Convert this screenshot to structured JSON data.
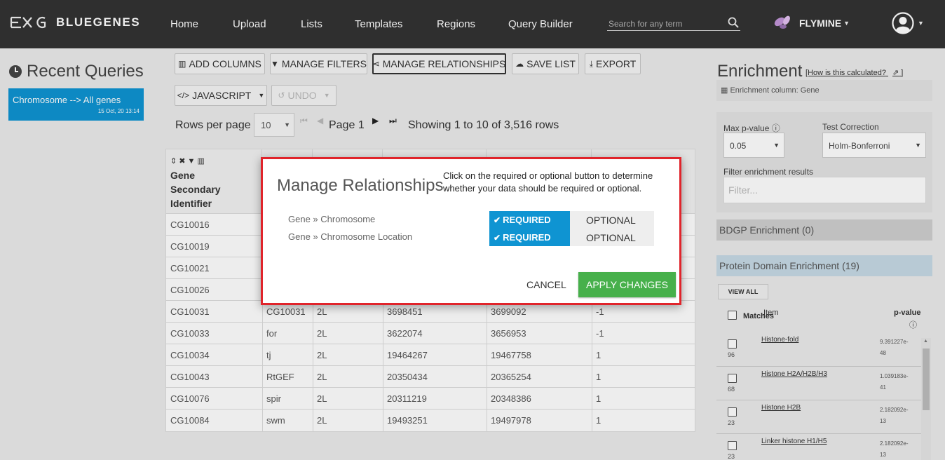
{
  "navbar": {
    "logo_text": "BLUEGENES",
    "links": [
      "Home",
      "Upload",
      "Lists",
      "Templates",
      "Regions",
      "Query Builder"
    ],
    "search_placeholder": "Search for any term",
    "mine_name": "FLYMINE"
  },
  "recent": {
    "title": "Recent Queries",
    "items": [
      {
        "title": "Chromosome --> All genes",
        "date": "15 Oct, 20 13:14"
      }
    ]
  },
  "toolbar": {
    "add_columns": "ADD COLUMNS",
    "manage_filters": "MANAGE FILTERS",
    "manage_relationships": "MANAGE RELATIONSHIPS",
    "save_list": "SAVE LIST",
    "export": "EXPORT",
    "javascript": "JAVASCRIPT",
    "undo": "UNDO"
  },
  "pagination": {
    "rows_per_page_label": "Rows per page",
    "rows_per_page_value": "10",
    "page_label": "Page 1",
    "showing": "Showing 1 to 10 of 3,516 rows"
  },
  "table": {
    "first_header": "Gene Secondary Identifier",
    "rows": [
      [
        "CG10016",
        "",
        "",
        "",
        "",
        ""
      ],
      [
        "CG10019",
        "",
        "",
        "",
        "",
        ""
      ],
      [
        "CG10021",
        "",
        "",
        "",
        "",
        ""
      ],
      [
        "CG10026",
        "",
        "",
        "",
        "",
        ""
      ],
      [
        "CG10031",
        "CG10031",
        "2L",
        "3698451",
        "3699092",
        "-1"
      ],
      [
        "CG10033",
        "for",
        "2L",
        "3622074",
        "3656953",
        "-1"
      ],
      [
        "CG10034",
        "tj",
        "2L",
        "19464267",
        "19467758",
        "1"
      ],
      [
        "CG10043",
        "RtGEF",
        "2L",
        "20350434",
        "20365254",
        "1"
      ],
      [
        "CG10076",
        "spir",
        "2L",
        "20311219",
        "20348386",
        "1"
      ],
      [
        "CG10084",
        "swm",
        "2L",
        "19493251",
        "19497978",
        "1"
      ]
    ]
  },
  "enrichment": {
    "title": "Enrichment",
    "help_link": "[How is this calculated?",
    "help_close": "]",
    "column_label": "Enrichment column: Gene",
    "max_p_label": "Max p-value",
    "max_p_value": "0.05",
    "test_correction_label": "Test Correction",
    "test_correction_value": "Holm-Bonferroni",
    "filter_label": "Filter enrichment results",
    "filter_placeholder": "Filter...",
    "bdgp": "BDGP Enrichment (0)",
    "protein": "Protein Domain Enrichment (19)",
    "view_all": "VIEW ALL",
    "matches_header": "Matches",
    "item_header": "Item",
    "pvalue_header": "p-value",
    "rows": [
      {
        "count": "96",
        "item": "Histone-fold",
        "p1": "9.391227e-",
        "p2": "48"
      },
      {
        "count": "68",
        "item": "Histone H2A/H2B/H3",
        "p1": "1.039183e-",
        "p2": "41"
      },
      {
        "count": "23",
        "item": "Histone H2B",
        "p1": "2.182092e-",
        "p2": "13"
      },
      {
        "count": "23",
        "item": "Linker histone H1/H5",
        "p1": "2.182092e-",
        "p2": "13"
      }
    ]
  },
  "modal": {
    "title": "Manage Relationships",
    "description": "Click on the required or optional button to determine whether your data should be required or optional.",
    "relationships": [
      {
        "path": "Gene » Chromosome",
        "required": "REQUIRED",
        "optional": "OPTIONAL"
      },
      {
        "path": "Gene » Chromosome Location",
        "required": "REQUIRED",
        "optional": "OPTIONAL"
      }
    ],
    "cancel": "CANCEL",
    "apply": "APPLY CHANGES"
  },
  "colors": {
    "accent_blue": "#0f94d2",
    "apply_green": "#47b04b",
    "highlight_red": "#e0242b",
    "navbar": "#2f2f2f"
  }
}
